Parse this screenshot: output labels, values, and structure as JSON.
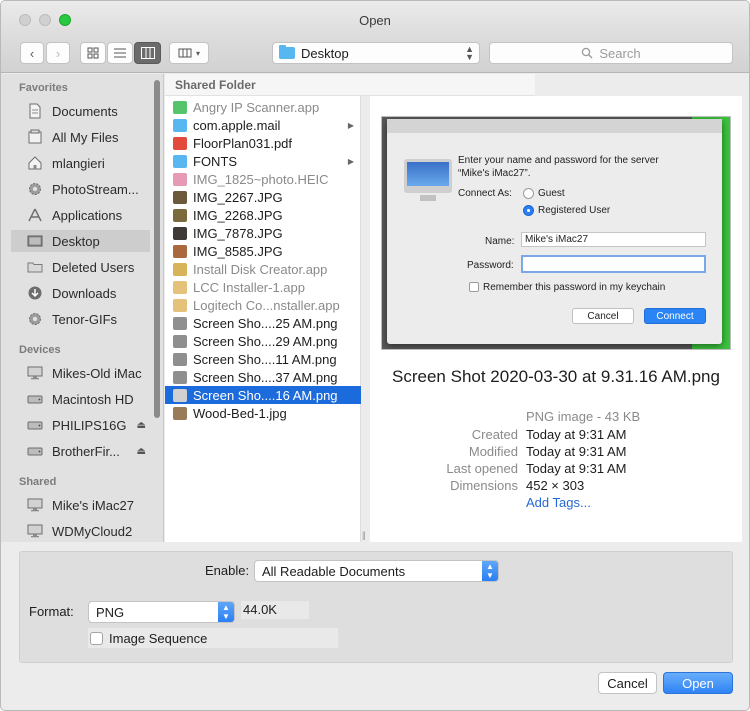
{
  "window": {
    "title": "Open"
  },
  "toolbar": {
    "location": "Desktop",
    "search_placeholder": "Search"
  },
  "sidebar": {
    "favorites_header": "Favorites",
    "favorites": [
      {
        "label": "Documents",
        "icon": "document-icon"
      },
      {
        "label": "All My Files",
        "icon": "all-files-icon"
      },
      {
        "label": "mlangieri",
        "icon": "home-icon"
      },
      {
        "label": "PhotoStream...",
        "icon": "gear-icon"
      },
      {
        "label": "Applications",
        "icon": "applications-icon"
      },
      {
        "label": "Desktop",
        "icon": "desktop-icon",
        "selected": true
      },
      {
        "label": "Deleted Users",
        "icon": "folder-icon"
      },
      {
        "label": "Downloads",
        "icon": "download-icon"
      },
      {
        "label": "Tenor-GIFs",
        "icon": "gear-icon"
      }
    ],
    "devices_header": "Devices",
    "devices": [
      {
        "label": "Mikes-Old iMac",
        "icon": "monitor-icon"
      },
      {
        "label": "Macintosh HD",
        "icon": "drive-icon"
      },
      {
        "label": "PHILIPS16G",
        "icon": "drive-icon",
        "eject": "⏏"
      },
      {
        "label": "BrotherFir...",
        "icon": "drive-icon",
        "eject": "⏏"
      }
    ],
    "shared_header": "Shared",
    "shared": [
      {
        "label": "Mike's iMac27",
        "icon": "monitor-icon"
      },
      {
        "label": "WDMyCloud2",
        "icon": "monitor-icon"
      }
    ]
  },
  "browser": {
    "column_header": "Shared Folder",
    "files": [
      {
        "name": "Angry IP Scanner.app",
        "dim": true,
        "icon_color": "#56c46a"
      },
      {
        "name": "com.apple.mail",
        "folder": true
      },
      {
        "name": "FloorPlan031.pdf",
        "icon_color": "#e24a3b"
      },
      {
        "name": "FONTS",
        "folder": true
      },
      {
        "name": "IMG_1825~photo.HEIC",
        "dim": true,
        "icon_color": "#e79ab5"
      },
      {
        "name": "IMG_2267.JPG",
        "icon_color": "#6d5a3a"
      },
      {
        "name": "IMG_2268.JPG",
        "icon_color": "#7a6a3c"
      },
      {
        "name": "IMG_7878.JPG",
        "icon_color": "#3f3a36"
      },
      {
        "name": "IMG_8585.JPG",
        "icon_color": "#a9683e"
      },
      {
        "name": "Install Disk Creator.app",
        "dim": true,
        "icon_color": "#d8b35a"
      },
      {
        "name": "LCC Installer-1.app",
        "dim": true,
        "icon_color": "#e4c27a"
      },
      {
        "name": "Logitech Co...nstaller.app",
        "dim": true,
        "icon_color": "#e4c27a"
      },
      {
        "name": "Screen Sho....25 AM.png",
        "icon_color": "#8f8f8f"
      },
      {
        "name": "Screen Sho....29 AM.png",
        "icon_color": "#8f8f8f"
      },
      {
        "name": "Screen Sho....11 AM.png",
        "icon_color": "#8f8f8f"
      },
      {
        "name": "Screen Sho....37 AM.png",
        "icon_color": "#8f8f8f"
      },
      {
        "name": "Screen Sho....16 AM.png",
        "selected": true,
        "icon_color": "#d0d0d0"
      },
      {
        "name": "Wood-Bed-1.jpg",
        "icon_color": "#9a7b58"
      }
    ]
  },
  "preview": {
    "dialog": {
      "prompt_line1": "Enter your name and password for the server",
      "prompt_line2": "“Mike's iMac27”.",
      "connect_as": "Connect As:",
      "guest": "Guest",
      "registered": "Registered User",
      "name_label": "Name:",
      "name_value": "Mike's iMac27",
      "password_label": "Password:",
      "remember": "Remember this password in my keychain",
      "cancel": "Cancel",
      "connect": "Connect"
    },
    "filename": "Screen Shot 2020-03-30 at 9.31.16 AM.png",
    "type": "PNG image - 43 KB",
    "created_label": "Created",
    "created": "Today at 9:31 AM",
    "modified_label": "Modified",
    "modified": "Today at 9:31 AM",
    "opened_label": "Last opened",
    "opened": "Today at 9:31 AM",
    "dimensions_label": "Dimensions",
    "dimensions": "452 × 303",
    "add_tags": "Add Tags..."
  },
  "options": {
    "enable_label": "Enable:",
    "enable_value": "All Readable Documents",
    "format_label": "Format:",
    "format_value": "PNG",
    "size": "44.0K",
    "image_sequence": "Image Sequence"
  },
  "buttons": {
    "cancel": "Cancel",
    "open": "Open"
  },
  "colors": {
    "accent": "#2e83f4",
    "selection": "#1c6bdc",
    "zoom_button": "#28c840"
  }
}
